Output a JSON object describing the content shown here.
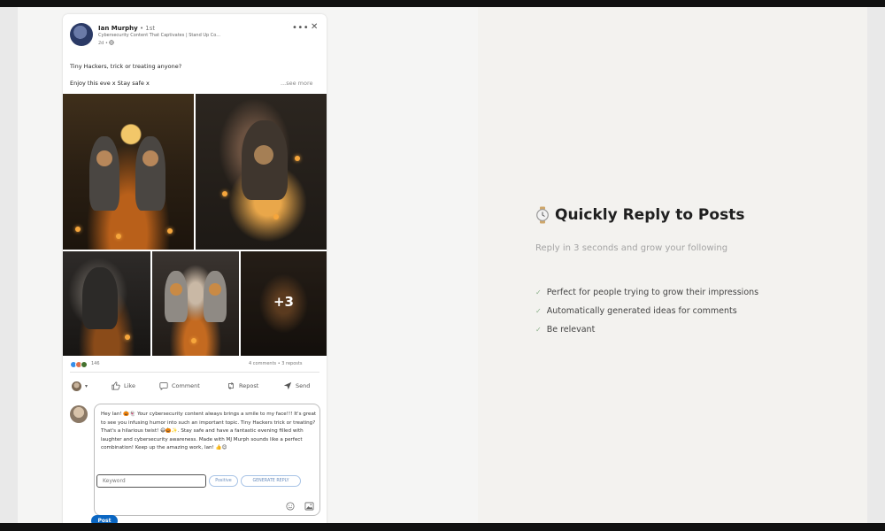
{
  "post": {
    "author_name": "Ian Murphy",
    "author_connection": " • 1st",
    "headline": "Cybersecurity Content That Captivates | Stand Up Co...",
    "time": "2d • ",
    "text_line1": "Tiny Hackers, trick or treating anyone?",
    "text_line2": "Enjoy this eve x Stay safe x",
    "see_more": "...see more",
    "more_images": "+3",
    "reaction_count": "146",
    "stats": "4 comments • 3 reposts"
  },
  "actions": {
    "like": "Like",
    "comment": "Comment",
    "repost": "Repost",
    "send": "Send"
  },
  "comment": {
    "text": "Hey Ian! 🎃👻 Your cybersecurity content always brings a smile to my face!!! It's great to see you infusing humor into such an important topic. Tiny Hackers trick or treating? That's a hilarious twist! 😄🎃✨. Stay safe and have a fantastic evening filled with laughter and cybersecurity awareness. Made with MJ Murph sounds like a perfect combination! Keep up the amazing work, Ian! 👍😊",
    "keyword_placeholder": "Keyword",
    "positive_label": "Positive",
    "generate_label": "GENERATE REPLY",
    "post_button": "Post"
  },
  "feature": {
    "title": "Quickly Reply to Posts",
    "subtitle": "Reply in 3 seconds and grow your following",
    "items": [
      "Perfect for people trying to grow their impressions",
      "Automatically generated ideas for comments",
      "Be relevant"
    ],
    "check_glyph": "✓"
  },
  "colors": {
    "accent": "#0a66c2",
    "pill_border": "#a8c3e6"
  }
}
